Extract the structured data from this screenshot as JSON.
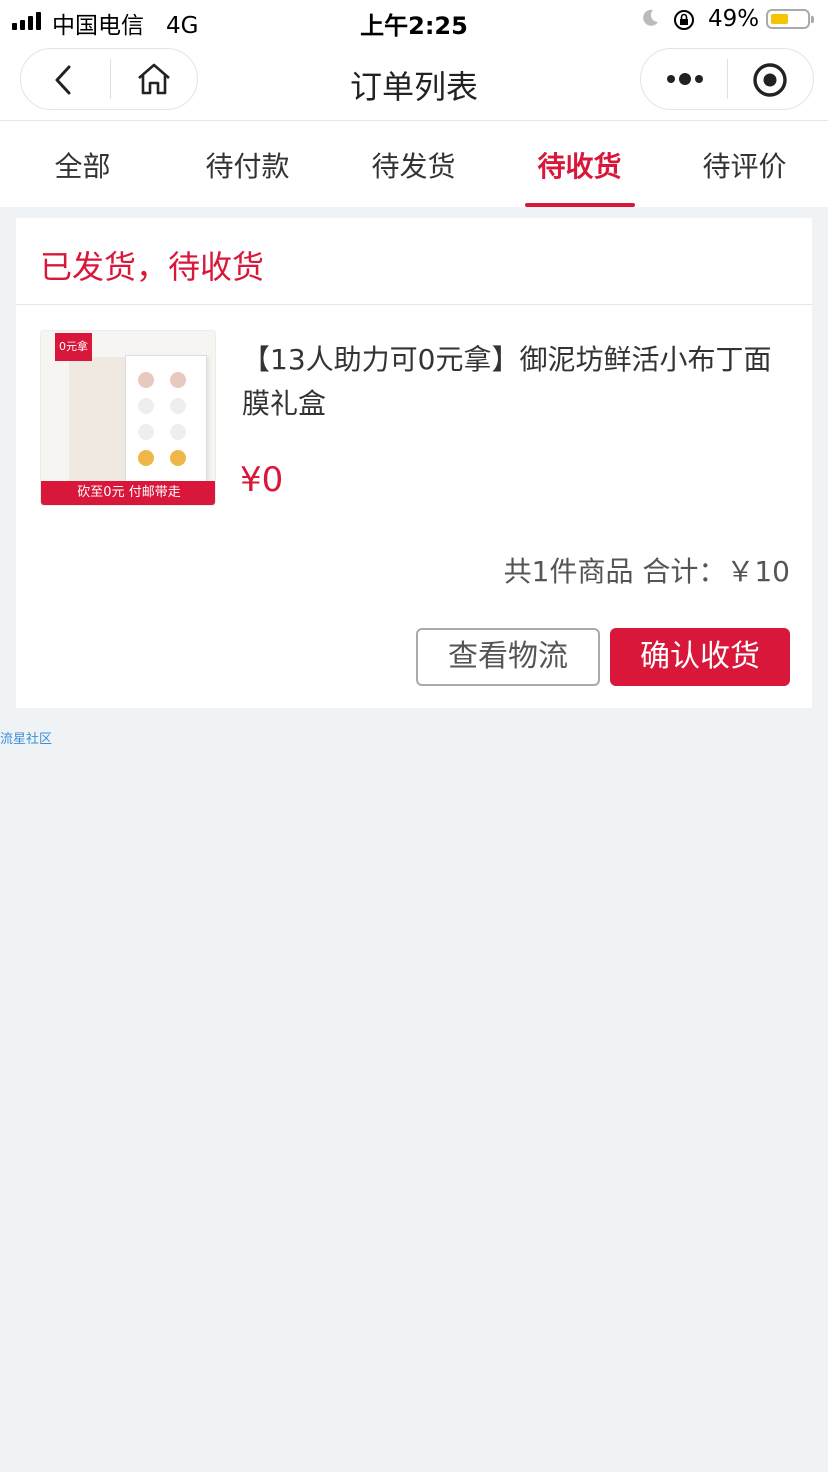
{
  "status_bar": {
    "carrier": "中国电信",
    "network": "4G",
    "time": "上午2:25",
    "battery_percent": "49%",
    "battery_level": 0.49,
    "icons": [
      "signal-icon",
      "moon-icon",
      "orientation-lock-icon",
      "battery-icon"
    ]
  },
  "nav": {
    "title": "订单列表",
    "icons": [
      "back-icon",
      "home-icon",
      "more-icon",
      "target-icon"
    ]
  },
  "tabs": [
    {
      "label": "全部",
      "active": false
    },
    {
      "label": "待付款",
      "active": false
    },
    {
      "label": "待发货",
      "active": false
    },
    {
      "label": "待收货",
      "active": true
    },
    {
      "label": "待评价",
      "active": false
    }
  ],
  "order": {
    "status": "已发货，待收货",
    "product": {
      "badge": "0元拿",
      "image_strip": "砍至0元 付邮带走",
      "name": "【13人助力可0元拿】御泥坊鲜活小布丁面膜礼盒",
      "price": "¥0"
    },
    "summary": "共1件商品 合计：￥10",
    "buttons": {
      "logistics": "查看物流",
      "confirm": "确认收货"
    }
  },
  "watermark": "流星社区",
  "colors": {
    "accent": "#d8173a",
    "background": "#eff3f6",
    "watermark": "#3d8fd6",
    "battery_fill": "#f5c400"
  }
}
